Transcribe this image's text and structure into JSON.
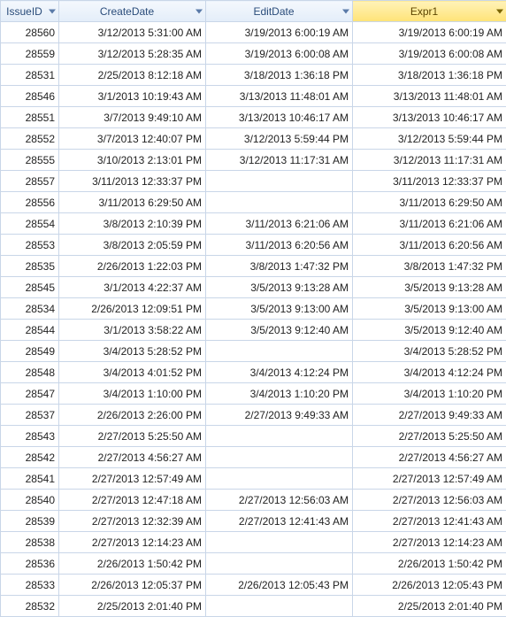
{
  "columns": {
    "issueId": "IssueID",
    "createDate": "CreateDate",
    "editDate": "EditDate",
    "expr1": "Expr1"
  },
  "rows": [
    {
      "id": "28560",
      "create": "3/12/2013 5:31:00 AM",
      "edit": "3/19/2013 6:00:19 AM",
      "expr": "3/19/2013 6:00:19 AM"
    },
    {
      "id": "28559",
      "create": "3/12/2013 5:28:35 AM",
      "edit": "3/19/2013 6:00:08 AM",
      "expr": "3/19/2013 6:00:08 AM"
    },
    {
      "id": "28531",
      "create": "2/25/2013 8:12:18 AM",
      "edit": "3/18/2013 1:36:18 PM",
      "expr": "3/18/2013 1:36:18 PM"
    },
    {
      "id": "28546",
      "create": "3/1/2013 10:19:43 AM",
      "edit": "3/13/2013 11:48:01 AM",
      "expr": "3/13/2013 11:48:01 AM"
    },
    {
      "id": "28551",
      "create": "3/7/2013 9:49:10 AM",
      "edit": "3/13/2013 10:46:17 AM",
      "expr": "3/13/2013 10:46:17 AM"
    },
    {
      "id": "28552",
      "create": "3/7/2013 12:40:07 PM",
      "edit": "3/12/2013 5:59:44 PM",
      "expr": "3/12/2013 5:59:44 PM"
    },
    {
      "id": "28555",
      "create": "3/10/2013 2:13:01 PM",
      "edit": "3/12/2013 11:17:31 AM",
      "expr": "3/12/2013 11:17:31 AM"
    },
    {
      "id": "28557",
      "create": "3/11/2013 12:33:37 PM",
      "edit": "",
      "expr": "3/11/2013 12:33:37 PM"
    },
    {
      "id": "28556",
      "create": "3/11/2013 6:29:50 AM",
      "edit": "",
      "expr": "3/11/2013 6:29:50 AM"
    },
    {
      "id": "28554",
      "create": "3/8/2013 2:10:39 PM",
      "edit": "3/11/2013 6:21:06 AM",
      "expr": "3/11/2013 6:21:06 AM"
    },
    {
      "id": "28553",
      "create": "3/8/2013 2:05:59 PM",
      "edit": "3/11/2013 6:20:56 AM",
      "expr": "3/11/2013 6:20:56 AM"
    },
    {
      "id": "28535",
      "create": "2/26/2013 1:22:03 PM",
      "edit": "3/8/2013 1:47:32 PM",
      "expr": "3/8/2013 1:47:32 PM"
    },
    {
      "id": "28545",
      "create": "3/1/2013 4:22:37 AM",
      "edit": "3/5/2013 9:13:28 AM",
      "expr": "3/5/2013 9:13:28 AM"
    },
    {
      "id": "28534",
      "create": "2/26/2013 12:09:51 PM",
      "edit": "3/5/2013 9:13:00 AM",
      "expr": "3/5/2013 9:13:00 AM"
    },
    {
      "id": "28544",
      "create": "3/1/2013 3:58:22 AM",
      "edit": "3/5/2013 9:12:40 AM",
      "expr": "3/5/2013 9:12:40 AM"
    },
    {
      "id": "28549",
      "create": "3/4/2013 5:28:52 PM",
      "edit": "",
      "expr": "3/4/2013 5:28:52 PM"
    },
    {
      "id": "28548",
      "create": "3/4/2013 4:01:52 PM",
      "edit": "3/4/2013 4:12:24 PM",
      "expr": "3/4/2013 4:12:24 PM"
    },
    {
      "id": "28547",
      "create": "3/4/2013 1:10:00 PM",
      "edit": "3/4/2013 1:10:20 PM",
      "expr": "3/4/2013 1:10:20 PM"
    },
    {
      "id": "28537",
      "create": "2/26/2013 2:26:00 PM",
      "edit": "2/27/2013 9:49:33 AM",
      "expr": "2/27/2013 9:49:33 AM"
    },
    {
      "id": "28543",
      "create": "2/27/2013 5:25:50 AM",
      "edit": "",
      "expr": "2/27/2013 5:25:50 AM"
    },
    {
      "id": "28542",
      "create": "2/27/2013 4:56:27 AM",
      "edit": "",
      "expr": "2/27/2013 4:56:27 AM"
    },
    {
      "id": "28541",
      "create": "2/27/2013 12:57:49 AM",
      "edit": "",
      "expr": "2/27/2013 12:57:49 AM"
    },
    {
      "id": "28540",
      "create": "2/27/2013 12:47:18 AM",
      "edit": "2/27/2013 12:56:03 AM",
      "expr": "2/27/2013 12:56:03 AM"
    },
    {
      "id": "28539",
      "create": "2/27/2013 12:32:39 AM",
      "edit": "2/27/2013 12:41:43 AM",
      "expr": "2/27/2013 12:41:43 AM"
    },
    {
      "id": "28538",
      "create": "2/27/2013 12:14:23 AM",
      "edit": "",
      "expr": "2/27/2013 12:14:23 AM"
    },
    {
      "id": "28536",
      "create": "2/26/2013 1:50:42 PM",
      "edit": "",
      "expr": "2/26/2013 1:50:42 PM"
    },
    {
      "id": "28533",
      "create": "2/26/2013 12:05:37 PM",
      "edit": "2/26/2013 12:05:43 PM",
      "expr": "2/26/2013 12:05:43 PM"
    },
    {
      "id": "28532",
      "create": "2/25/2013 2:01:40 PM",
      "edit": "",
      "expr": "2/25/2013 2:01:40 PM"
    }
  ]
}
